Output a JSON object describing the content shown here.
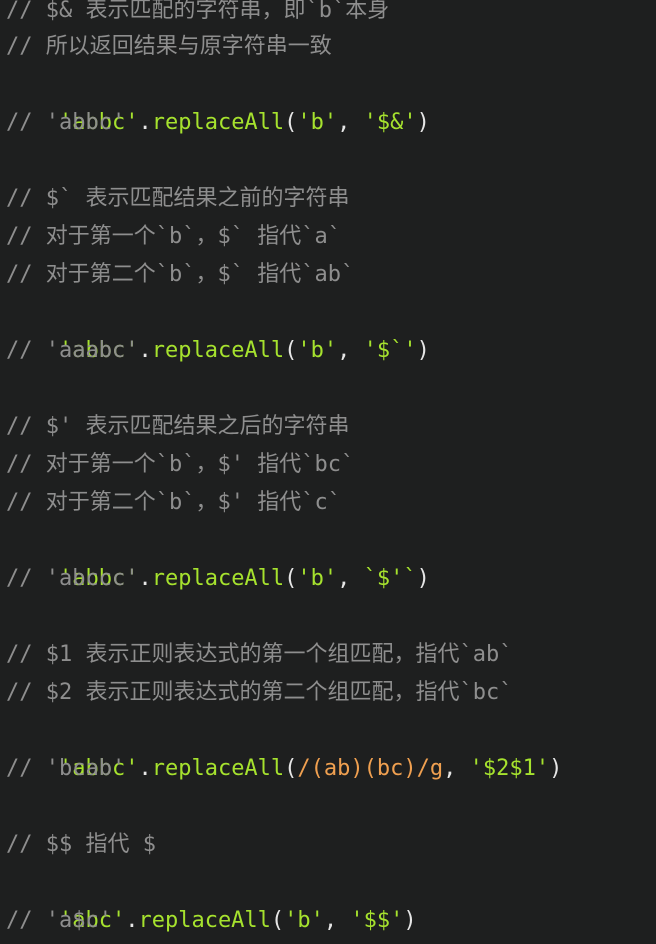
{
  "lines": [
    {
      "comment": "// $& 表示匹配的字符串，即`b`本身"
    },
    {
      "comment": "// 所以返回结果与原字符串一致"
    },
    {
      "code": [
        "'abbc'",
        ".",
        "replaceAll",
        "(",
        "'b'",
        ", ",
        "'$&'",
        ")"
      ]
    },
    {
      "comment": "// 'abbc'"
    },
    {
      "blank": true
    },
    {
      "comment": "// $` 表示匹配结果之前的字符串"
    },
    {
      "comment": "// 对于第一个`b`，$` 指代`a`"
    },
    {
      "comment": "// 对于第二个`b`，$` 指代`ab`"
    },
    {
      "code": [
        "'abbc'",
        ".",
        "replaceAll",
        "(",
        "'b'",
        ", ",
        "'$`'",
        ")"
      ]
    },
    {
      "comment": "// 'aaabc'"
    },
    {
      "blank": true
    },
    {
      "comment": "// $' 表示匹配结果之后的字符串"
    },
    {
      "comment": "// 对于第一个`b`，$' 指代`bc`"
    },
    {
      "comment": "// 对于第二个`b`，$' 指代`c`"
    },
    {
      "code": [
        "'abbc'",
        ".",
        "replaceAll",
        "(",
        "'b'",
        ", ",
        "`$'`",
        ")"
      ]
    },
    {
      "comment": "// 'abccc'"
    },
    {
      "blank": true
    },
    {
      "comment": "// $1 表示正则表达式的第一个组匹配，指代`ab`"
    },
    {
      "comment": "// $2 表示正则表达式的第二个组匹配，指代`bc`"
    },
    {
      "code": [
        "'abbc'",
        ".",
        "replaceAll",
        "(",
        "/(ab)(bc)/g",
        ", ",
        "'$2$1'",
        ")"
      ]
    },
    {
      "comment": "// 'bcab'"
    },
    {
      "blank": true
    },
    {
      "comment": "// $$ 指代 $"
    },
    {
      "code": [
        "'abc'",
        ".",
        "replaceAll",
        "(",
        "'b'",
        ", ",
        "'$$'",
        ")"
      ]
    },
    {
      "comment": "// 'a$c'"
    }
  ],
  "colors": {
    "background": "#1e1f1f",
    "comment": "#8e8e8e",
    "string": "#a6e22e",
    "regex": "#f0a050",
    "punctuation": "#e6e6e6"
  }
}
